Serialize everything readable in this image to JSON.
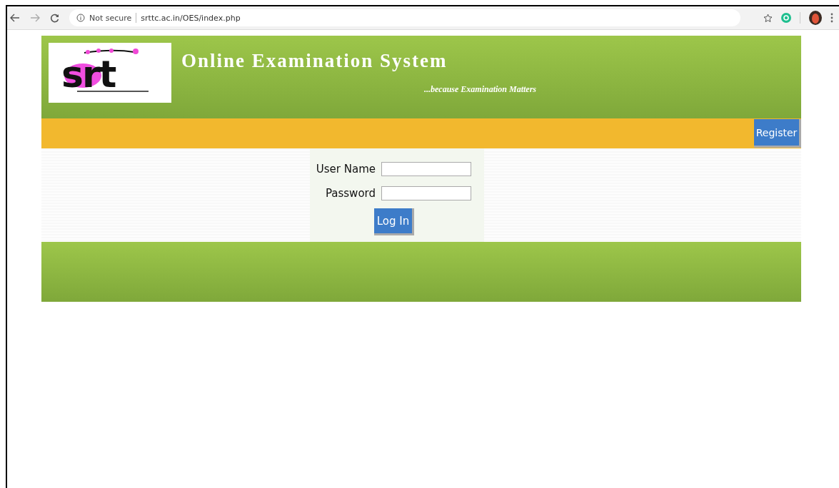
{
  "browser": {
    "security": "Not secure",
    "url": "srttc.ac.in/OES/index.php"
  },
  "header": {
    "logo_text": "srt",
    "title": "Online Examination System",
    "tagline": "...because Examination Matters"
  },
  "nav": {
    "register": "Register"
  },
  "login": {
    "fields": [
      {
        "label": "User Name"
      },
      {
        "label": "Password"
      }
    ],
    "submit": "Log In"
  }
}
